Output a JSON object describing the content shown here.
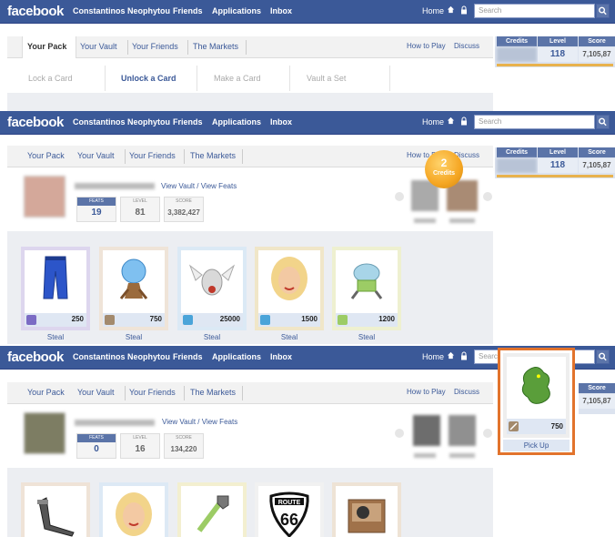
{
  "facebook": {
    "logo": "facebook",
    "user": "Constantinos Neophytou",
    "nav": [
      "Friends",
      "Applications",
      "Inbox"
    ],
    "home": "Home",
    "search_placeholder": "Search"
  },
  "app_tabs": {
    "items": [
      "Your Pack",
      "Your Vault",
      "Your Friends",
      "The Markets"
    ],
    "right_links": [
      "How to Play",
      "Discuss"
    ]
  },
  "subtabs": [
    "Lock a Card",
    "Unlock a Card",
    "Make a Card",
    "Vault a Set"
  ],
  "stats_panel": {
    "headers": [
      "Credits",
      "Level",
      "Score"
    ],
    "level": "118",
    "score": "7,105,87"
  },
  "screen2": {
    "links": [
      "View Vault",
      "View Feats"
    ],
    "link_sep": "/",
    "feats_label": "FEATS",
    "level_label": "LEVEL",
    "score_label": "SCORE",
    "feats": "19",
    "level": "81",
    "score": "3,382,427",
    "credits_badge": {
      "count": "2",
      "label": "Credits"
    },
    "cards": [
      {
        "price": "250",
        "action": "Steal",
        "icon": "jeans-icon"
      },
      {
        "price": "750",
        "action": "Steal",
        "icon": "crystal-ball-icon"
      },
      {
        "price": "25000",
        "action": "Steal",
        "icon": "winged-helmet-icon"
      },
      {
        "price": "1500",
        "action": "Steal",
        "icon": "blonde-woman-icon"
      },
      {
        "price": "1200",
        "action": "Steal",
        "icon": "alien-robot-icon"
      }
    ]
  },
  "screen3": {
    "feats": "0",
    "level": "16",
    "score": "134,220",
    "score_header": "Score",
    "score_value": "7,105,87",
    "cards": [
      {
        "icon": "treadmill-icon"
      },
      {
        "icon": "blonde-woman-icon"
      },
      {
        "icon": "pipe-wrench-icon"
      },
      {
        "icon": "route-66-icon",
        "text_top": "ROUTE",
        "text_num": "66"
      },
      {
        "icon": "record-player-icon"
      }
    ],
    "pickup": {
      "price": "750",
      "action": "Pick Up",
      "icon": "dragon-icon"
    }
  },
  "colors": {
    "fb_blue": "#3b5998",
    "highlight_orange": "#e2732c",
    "badge_gold": "#f5a623"
  }
}
